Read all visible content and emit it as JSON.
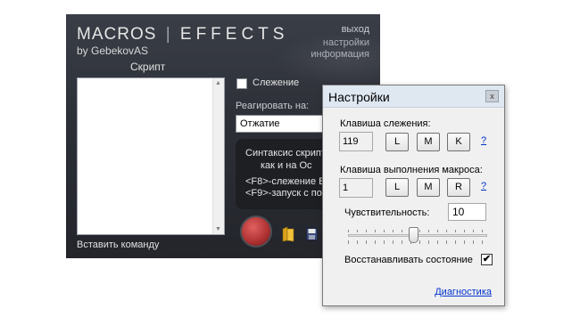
{
  "main": {
    "title": "MACROS",
    "title_effects": "EFFECTS",
    "subtitle": "by GebekovAS",
    "menu": {
      "exit": "выход",
      "settings": "настройки",
      "info": "информация"
    },
    "script_label": "Скрипт",
    "insert_command": "Вставить команду",
    "tracking_label": "Слежение",
    "react_label": "Реагировать на:",
    "react_value": "Отжатие",
    "syntax_lines": [
      "Синтаксис скрипто",
      "как и на Ос",
      "<F8>-слежение В",
      "<F9>-запуск с по"
    ],
    "record_color": "#c0392b"
  },
  "dialog": {
    "title": "Настройки",
    "close_glyph": "x",
    "tracking_key_label": "Клавиша слежения:",
    "tracking_key_code": "119",
    "tracking_key_buttons": [
      "L",
      "M",
      "K"
    ],
    "exec_key_label": "Клавиша выполнения макроса:",
    "exec_key_code": "1",
    "exec_key_buttons": [
      "L",
      "M",
      "R"
    ],
    "help": "?",
    "sensitivity_label": "Чувствительность:",
    "sensitivity_value": "10",
    "slider_level": 0.47,
    "restore_label": "Восстанавливать состояние",
    "restore_checked": true,
    "diagnostics_link": "Диагностика"
  }
}
